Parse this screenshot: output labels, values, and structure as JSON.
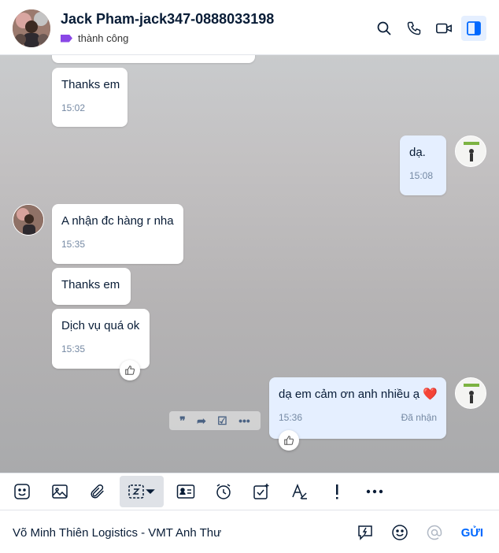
{
  "header": {
    "name": "Jack Pham-jack347-0888033198",
    "tag_label": "thành công",
    "tag_color": "#8a47e6",
    "actions": [
      "search-icon",
      "phone-icon",
      "video-call-icon",
      "sidebar-toggle-icon"
    ]
  },
  "messages": {
    "m1": {
      "text": "Thanks em",
      "time": "15:02"
    },
    "m2": {
      "text": "dạ.",
      "time": "15:08"
    },
    "m3": {
      "text": "A nhận đc hàng r nha",
      "time": "15:35"
    },
    "m4": {
      "text": "Thanks em"
    },
    "m5": {
      "text": "Dịch vụ quá ok",
      "time": "15:35"
    },
    "m6": {
      "text": "dạ em cảm ơn anh nhiều ạ",
      "emoji": "❤️",
      "time": "15:36",
      "status": "Đã nhận"
    }
  },
  "toolbar": {
    "items": [
      "sticker-icon",
      "image-icon",
      "attachment-icon",
      "screenshot-icon",
      "contact-card-icon",
      "reminder-icon",
      "task-icon",
      "format-text-icon",
      "important-icon",
      "more-icon"
    ]
  },
  "composer": {
    "value": "Võ Minh Thiên Logistics - VMT Anh Thư",
    "send_label": "GỬI"
  },
  "colors": {
    "accent": "#0068ff",
    "outgoing_bubble": "#e5efff"
  }
}
